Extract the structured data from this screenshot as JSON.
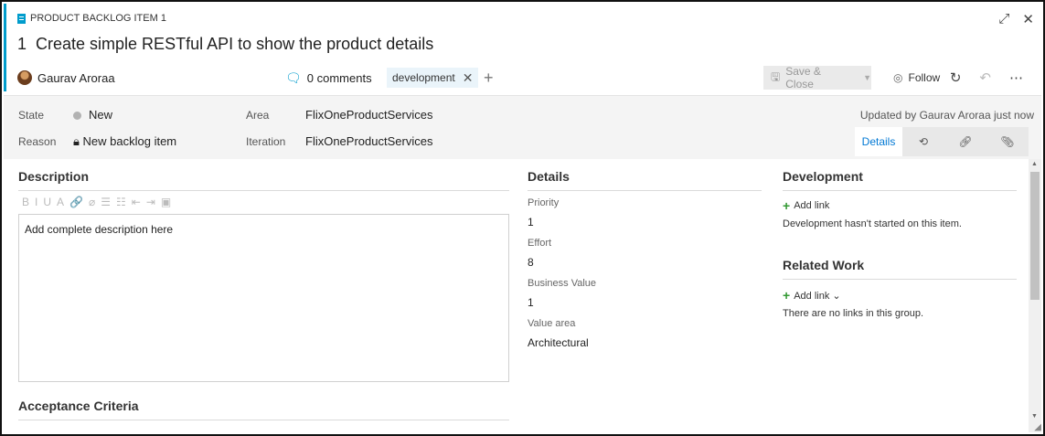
{
  "header": {
    "type_label": "PRODUCT BACKLOG ITEM 1",
    "item_id": "1",
    "title": "Create simple RESTful API to show the product details",
    "assignee": "Gaurav Aroraa",
    "comments": "0 comments",
    "tag": "development",
    "save_label": "Save & Close",
    "follow_label": "Follow",
    "accent_color": "#009ccc"
  },
  "fields": {
    "state_label": "State",
    "state_value": "New",
    "reason_label": "Reason",
    "reason_value": "New backlog item",
    "area_label": "Area",
    "area_value": "FlixOneProductServices",
    "iteration_label": "Iteration",
    "iteration_value": "FlixOneProductServices",
    "updated": "Updated by Gaurav Aroraa just now"
  },
  "tabs": {
    "details": "Details"
  },
  "description": {
    "title": "Description",
    "toolbar": [
      "B",
      "I",
      "U",
      "A",
      "🔗",
      "⌀",
      "☰",
      "☷",
      "⇤",
      "⇥",
      "▣"
    ],
    "text": "Add complete description here"
  },
  "acceptance": {
    "title": "Acceptance Criteria"
  },
  "details": {
    "title": "Details",
    "priority_label": "Priority",
    "priority_value": "1",
    "effort_label": "Effort",
    "effort_value": "8",
    "business_label": "Business Value",
    "business_value": "1",
    "value_area_label": "Value area",
    "value_area_value": "Architectural"
  },
  "development": {
    "title": "Development",
    "add_link": "Add link",
    "note": "Development hasn't started on this item."
  },
  "related": {
    "title": "Related Work",
    "add_link": "Add link ⌄",
    "note": "There are no links in this group."
  }
}
